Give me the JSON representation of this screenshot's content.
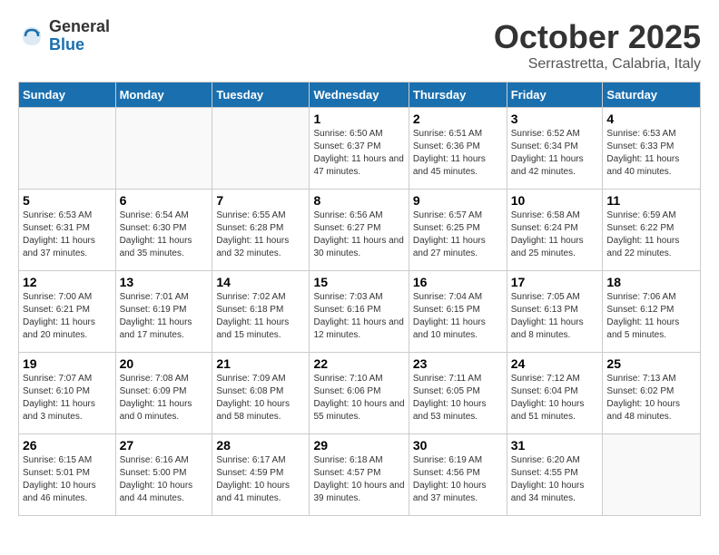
{
  "logo": {
    "general": "General",
    "blue": "Blue"
  },
  "title": "October 2025",
  "subtitle": "Serrastretta, Calabria, Italy",
  "days_of_week": [
    "Sunday",
    "Monday",
    "Tuesday",
    "Wednesday",
    "Thursday",
    "Friday",
    "Saturday"
  ],
  "weeks": [
    [
      {
        "day": "",
        "info": ""
      },
      {
        "day": "",
        "info": ""
      },
      {
        "day": "",
        "info": ""
      },
      {
        "day": "1",
        "info": "Sunrise: 6:50 AM\nSunset: 6:37 PM\nDaylight: 11 hours and 47 minutes."
      },
      {
        "day": "2",
        "info": "Sunrise: 6:51 AM\nSunset: 6:36 PM\nDaylight: 11 hours and 45 minutes."
      },
      {
        "day": "3",
        "info": "Sunrise: 6:52 AM\nSunset: 6:34 PM\nDaylight: 11 hours and 42 minutes."
      },
      {
        "day": "4",
        "info": "Sunrise: 6:53 AM\nSunset: 6:33 PM\nDaylight: 11 hours and 40 minutes."
      }
    ],
    [
      {
        "day": "5",
        "info": "Sunrise: 6:53 AM\nSunset: 6:31 PM\nDaylight: 11 hours and 37 minutes."
      },
      {
        "day": "6",
        "info": "Sunrise: 6:54 AM\nSunset: 6:30 PM\nDaylight: 11 hours and 35 minutes."
      },
      {
        "day": "7",
        "info": "Sunrise: 6:55 AM\nSunset: 6:28 PM\nDaylight: 11 hours and 32 minutes."
      },
      {
        "day": "8",
        "info": "Sunrise: 6:56 AM\nSunset: 6:27 PM\nDaylight: 11 hours and 30 minutes."
      },
      {
        "day": "9",
        "info": "Sunrise: 6:57 AM\nSunset: 6:25 PM\nDaylight: 11 hours and 27 minutes."
      },
      {
        "day": "10",
        "info": "Sunrise: 6:58 AM\nSunset: 6:24 PM\nDaylight: 11 hours and 25 minutes."
      },
      {
        "day": "11",
        "info": "Sunrise: 6:59 AM\nSunset: 6:22 PM\nDaylight: 11 hours and 22 minutes."
      }
    ],
    [
      {
        "day": "12",
        "info": "Sunrise: 7:00 AM\nSunset: 6:21 PM\nDaylight: 11 hours and 20 minutes."
      },
      {
        "day": "13",
        "info": "Sunrise: 7:01 AM\nSunset: 6:19 PM\nDaylight: 11 hours and 17 minutes."
      },
      {
        "day": "14",
        "info": "Sunrise: 7:02 AM\nSunset: 6:18 PM\nDaylight: 11 hours and 15 minutes."
      },
      {
        "day": "15",
        "info": "Sunrise: 7:03 AM\nSunset: 6:16 PM\nDaylight: 11 hours and 12 minutes."
      },
      {
        "day": "16",
        "info": "Sunrise: 7:04 AM\nSunset: 6:15 PM\nDaylight: 11 hours and 10 minutes."
      },
      {
        "day": "17",
        "info": "Sunrise: 7:05 AM\nSunset: 6:13 PM\nDaylight: 11 hours and 8 minutes."
      },
      {
        "day": "18",
        "info": "Sunrise: 7:06 AM\nSunset: 6:12 PM\nDaylight: 11 hours and 5 minutes."
      }
    ],
    [
      {
        "day": "19",
        "info": "Sunrise: 7:07 AM\nSunset: 6:10 PM\nDaylight: 11 hours and 3 minutes."
      },
      {
        "day": "20",
        "info": "Sunrise: 7:08 AM\nSunset: 6:09 PM\nDaylight: 11 hours and 0 minutes."
      },
      {
        "day": "21",
        "info": "Sunrise: 7:09 AM\nSunset: 6:08 PM\nDaylight: 10 hours and 58 minutes."
      },
      {
        "day": "22",
        "info": "Sunrise: 7:10 AM\nSunset: 6:06 PM\nDaylight: 10 hours and 55 minutes."
      },
      {
        "day": "23",
        "info": "Sunrise: 7:11 AM\nSunset: 6:05 PM\nDaylight: 10 hours and 53 minutes."
      },
      {
        "day": "24",
        "info": "Sunrise: 7:12 AM\nSunset: 6:04 PM\nDaylight: 10 hours and 51 minutes."
      },
      {
        "day": "25",
        "info": "Sunrise: 7:13 AM\nSunset: 6:02 PM\nDaylight: 10 hours and 48 minutes."
      }
    ],
    [
      {
        "day": "26",
        "info": "Sunrise: 6:15 AM\nSunset: 5:01 PM\nDaylight: 10 hours and 46 minutes."
      },
      {
        "day": "27",
        "info": "Sunrise: 6:16 AM\nSunset: 5:00 PM\nDaylight: 10 hours and 44 minutes."
      },
      {
        "day": "28",
        "info": "Sunrise: 6:17 AM\nSunset: 4:59 PM\nDaylight: 10 hours and 41 minutes."
      },
      {
        "day": "29",
        "info": "Sunrise: 6:18 AM\nSunset: 4:57 PM\nDaylight: 10 hours and 39 minutes."
      },
      {
        "day": "30",
        "info": "Sunrise: 6:19 AM\nSunset: 4:56 PM\nDaylight: 10 hours and 37 minutes."
      },
      {
        "day": "31",
        "info": "Sunrise: 6:20 AM\nSunset: 4:55 PM\nDaylight: 10 hours and 34 minutes."
      },
      {
        "day": "",
        "info": ""
      }
    ]
  ]
}
